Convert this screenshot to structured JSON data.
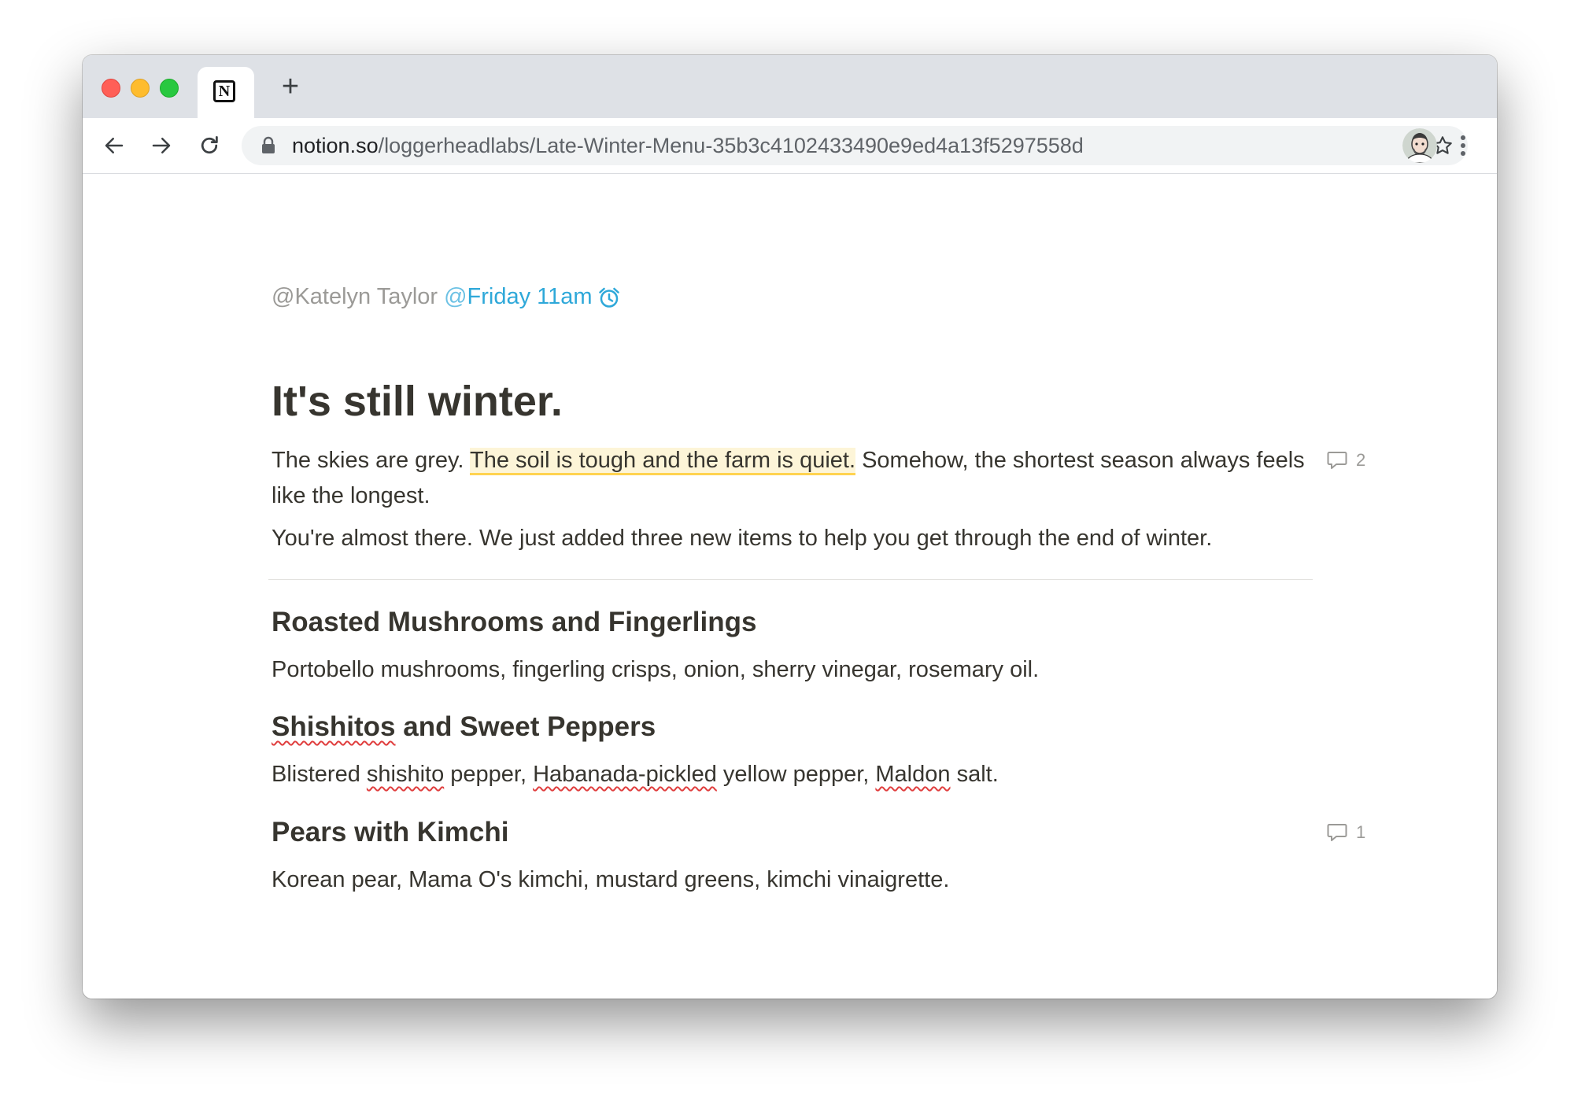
{
  "browser": {
    "tab_icon": "notion-logo-icon",
    "tab_logo_letter": "N",
    "new_tab_symbol": "+",
    "url_domain": "notion.so",
    "url_path": "/loggerheadlabs/Late-Winter-Menu-35b3c4102433490e9ed4a13f5297558d"
  },
  "page": {
    "mention_person": "@Katelyn Taylor",
    "mention_date_at": "@",
    "mention_date": "Friday 11am",
    "heading": "It's still winter.",
    "para1": {
      "before": "The skies are grey. ",
      "highlighted": "The soil is tough and the farm is quiet.",
      "after": " Somehow, the shortest season always feels like the longest."
    },
    "para2": "You're almost there. We just added three new items to help you get through the end of winter.",
    "comments": [
      {
        "count": "2"
      },
      {
        "count": "1"
      }
    ],
    "items": [
      {
        "title": "Roasted Mushrooms and Fingerlings",
        "desc": "Portobello mushrooms, fingerling crisps, onion, sherry vinegar, rosemary oil."
      },
      {
        "title_spell": "Shishitos",
        "title_rest": " and Sweet Peppers",
        "desc_parts": [
          "Blistered ",
          "shishito",
          " pepper, ",
          "Habanada-pickled",
          " yellow pepper, ",
          "Maldon",
          " salt."
        ]
      },
      {
        "title": "Pears with Kimchi",
        "desc": "Korean pear, Mama O's kimchi, mustard greens, kimchi vinaigrette."
      }
    ]
  },
  "colors": {
    "mention_date": "#2ea8d9",
    "highlight_bg": "#fdf5d8",
    "highlight_underline": "#ffd350",
    "text": "#37352f"
  }
}
